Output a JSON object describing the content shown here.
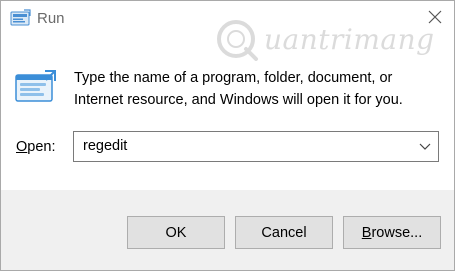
{
  "window": {
    "title": "Run",
    "watermark_text": "uantrimang"
  },
  "dialog": {
    "message_line1": "Type the name of a program, folder, document, or",
    "message_line2": "Internet resource, and Windows will open it for you.",
    "open_label_mnemonic": "O",
    "open_label_rest": "pen:",
    "input_value": "regedit"
  },
  "buttons": {
    "ok_label": "OK",
    "cancel_label": "Cancel",
    "browse_mnemonic": "B",
    "browse_rest": "rowse..."
  },
  "icons": {
    "app_icon": "run-icon",
    "close_icon": "close-icon",
    "dropdown_icon": "chevron-down-icon"
  },
  "colors": {
    "title_text": "#6b6b6b",
    "footer_bg": "#f0f0f0",
    "button_bg": "#e1e1e1",
    "button_border": "#adadad",
    "icon_blue": "#3b8ed8"
  }
}
